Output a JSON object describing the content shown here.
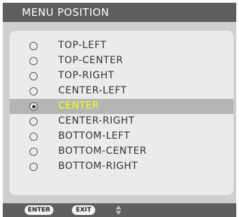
{
  "title": "MENU POSITION",
  "options": [
    {
      "label": "TOP-LEFT",
      "selected": false
    },
    {
      "label": "TOP-CENTER",
      "selected": false
    },
    {
      "label": "TOP-RIGHT",
      "selected": false
    },
    {
      "label": "CENTER-LEFT",
      "selected": false
    },
    {
      "label": "CENTER",
      "selected": true
    },
    {
      "label": "CENTER-RIGHT",
      "selected": false
    },
    {
      "label": "BOTTOM-LEFT",
      "selected": false
    },
    {
      "label": "BOTTOM-CENTER",
      "selected": false
    },
    {
      "label": "BOTTOM-RIGHT",
      "selected": false
    }
  ],
  "footer": {
    "enter_label": "ENTER",
    "exit_label": "EXIT",
    "nav_icon": "up-down-arrows-icon"
  },
  "colors": {
    "title_bar": "#5e5e5e",
    "selected_text": "#ffff00",
    "selected_row": "#b5b5b5"
  }
}
